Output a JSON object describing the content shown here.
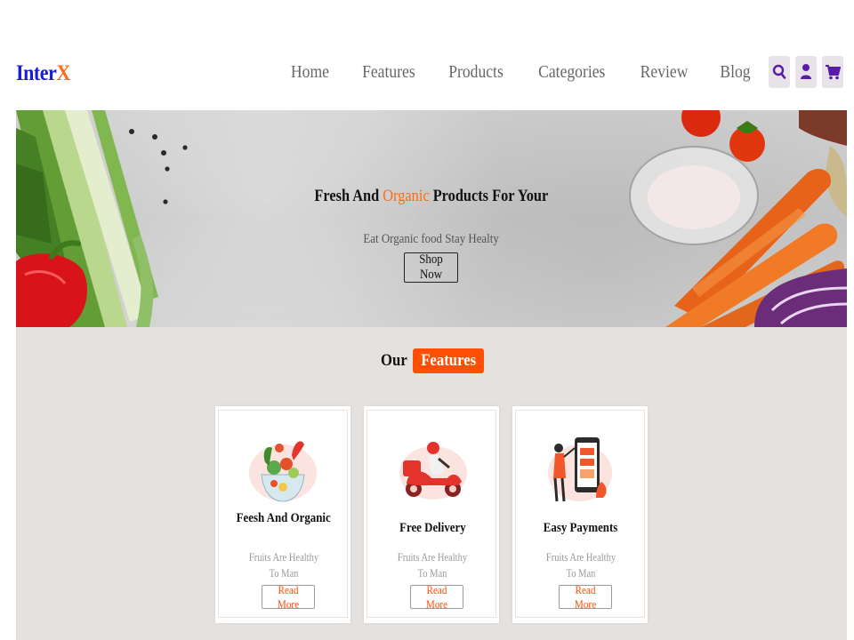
{
  "brand": {
    "name": "Inter",
    "accent": "X",
    "color": "#1a1adf",
    "accent_color": "#ff6a13"
  },
  "nav": {
    "links": [
      "Home",
      "Features",
      "Products",
      "Categories",
      "Review",
      "Blog"
    ],
    "icons": [
      "search-icon",
      "user-icon",
      "cart-icon"
    ],
    "icon_color": "#5b1aa8"
  },
  "hero": {
    "title_before": "Fresh And ",
    "title_highlight": "Organic",
    "title_after": " Products For Your",
    "subtitle": "Eat Organic food Stay Healty",
    "button": "Shop Now"
  },
  "features": {
    "heading": "Our",
    "heading_highlight": "Features",
    "accent_color": "#ff4f07",
    "cards": [
      {
        "title": "Feesh And Organic",
        "desc": "Fruits Are Healthy To Man",
        "button": "Read More",
        "image": "salad-bowl-illustration"
      },
      {
        "title": "Free Delivery",
        "desc": "Fruits Are Healthy To Man",
        "button": "Read More",
        "image": "delivery-scooter-illustration"
      },
      {
        "title": "Easy Payments",
        "desc": "Fruits Are Healthy To Man",
        "button": "Read More",
        "image": "mobile-payment-illustration"
      }
    ]
  }
}
